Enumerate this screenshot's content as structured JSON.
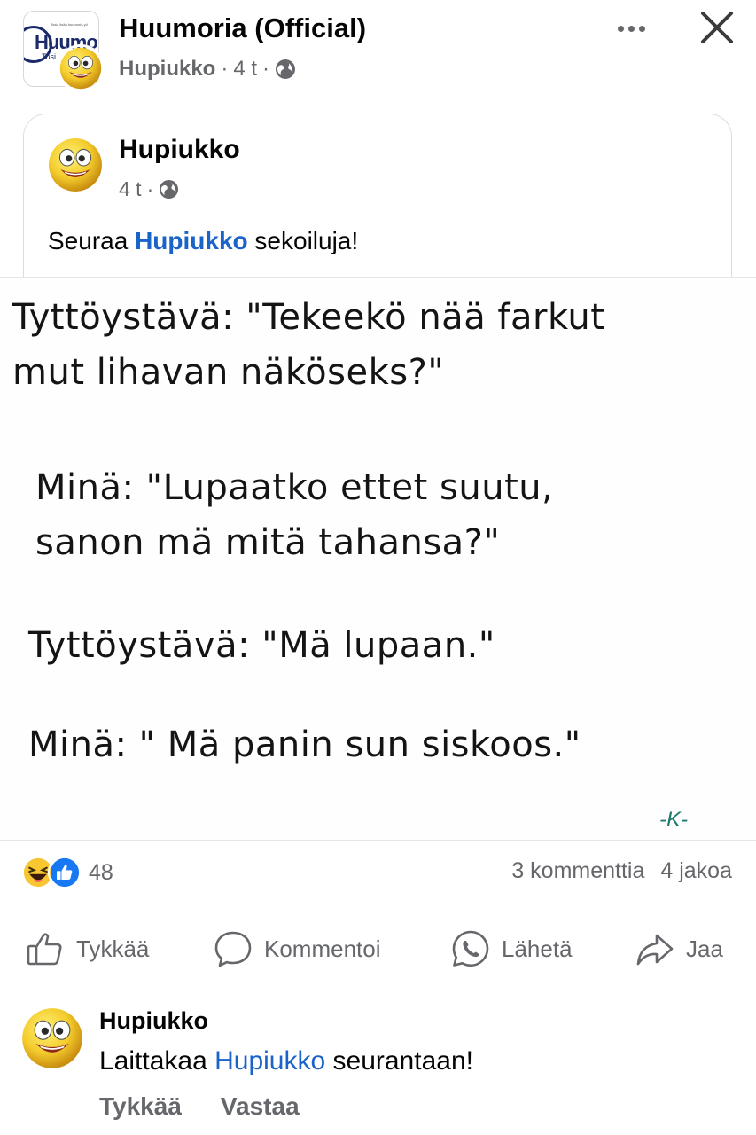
{
  "header": {
    "page_name": "Huumoria (Official)",
    "author": "Hupiukko",
    "time": "4 t",
    "separator": "·",
    "logo_text": "Huumo",
    "logo_sub": "Tosi",
    "logo_tiny": "Tosia lisää huumoria yö"
  },
  "shared_post": {
    "author": "Hupiukko",
    "time": "4 t",
    "separator": "·",
    "text_before": "Seuraa ",
    "mention": "Hupiukko",
    "text_after": " sekoiluja!"
  },
  "meme": {
    "lines": [
      "Tyttöystävä: \"Tekeekö nää farkut",
      "mut lihavan näköseks?\"",
      "Minä: \"Lupaatko ettet suutu,",
      "sanon mä mitä tahansa?\"",
      "Tyttöystävä: \"Mä lupaan.\"",
      "Minä: \" Mä panin sun siskoos.\""
    ],
    "signature": "-K-"
  },
  "reactions": {
    "count": "48",
    "types": [
      "haha-icon",
      "like-icon"
    ],
    "comments": "3 kommenttia",
    "shares": "4 jakoa"
  },
  "actions": {
    "like": "Tykkää",
    "comment": "Kommentoi",
    "send": "Lähetä",
    "share": "Jaa"
  },
  "comment": {
    "author": "Hupiukko",
    "text_before": "Laittakaa ",
    "mention": "Hupiukko",
    "text_after": " seurantaan!",
    "like": "Tykkää",
    "reply": "Vastaa"
  },
  "colors": {
    "mention": "#1a63c9",
    "secondary_text": "#65676b",
    "like_blue": "#1877f2",
    "haha_yellow": "#f7c631"
  }
}
